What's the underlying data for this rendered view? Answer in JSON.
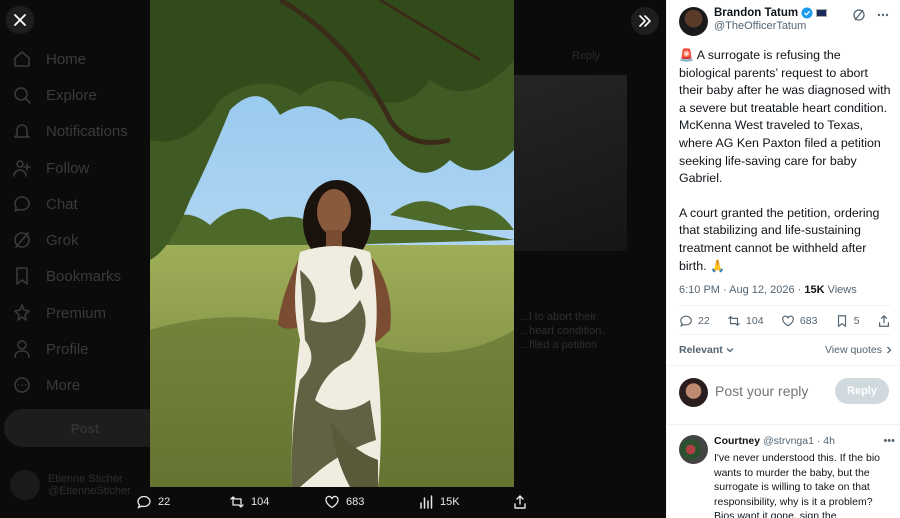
{
  "background_nav": {
    "items": [
      {
        "label": "Home",
        "icon": "home-icon"
      },
      {
        "label": "Explore",
        "icon": "search-icon"
      },
      {
        "label": "Notifications",
        "icon": "bell-icon"
      },
      {
        "label": "Follow",
        "icon": "follow-icon"
      },
      {
        "label": "Chat",
        "icon": "chat-icon"
      },
      {
        "label": "Grok",
        "icon": "grok-icon"
      },
      {
        "label": "Bookmarks",
        "icon": "bookmark-icon"
      },
      {
        "label": "Premium",
        "icon": "premium-icon"
      },
      {
        "label": "Profile",
        "icon": "profile-icon"
      },
      {
        "label": "More",
        "icon": "more-icon"
      }
    ],
    "post_label": "Post",
    "user_name": "Etienne Sticher",
    "user_handle": "@EtienneSticher",
    "right_label": "Reply",
    "right_text": "...l to abort their ...heart condition. ...filed a petition"
  },
  "media_actions": {
    "replies": "22",
    "reposts": "104",
    "likes": "683",
    "views": "15K"
  },
  "tweet": {
    "display_name": "Brandon Tatum",
    "handle": "@TheOfficerTatum",
    "emoji_prefix": "🚨",
    "paragraph1": "A surrogate is refusing the biological parents’ request to abort their baby after he was diagnosed with a severe but treatable heart condition. McKenna West traveled to Texas, where AG Ken Paxton filed a petition seeking life-saving care for baby Gabriel.",
    "paragraph2": "A court granted the petition, ordering that stabilizing and life-sustaining treatment cannot be withheld after birth.",
    "emoji_suffix": "🙏",
    "time": "6:10 PM · Aug 12, 2026 · ",
    "views_count": "15K",
    "views_label": " Views",
    "stats": {
      "replies": "22",
      "reposts": "104",
      "likes": "683",
      "bookmarks": "5"
    },
    "relevant_label": "Relevant",
    "view_quotes_label": "View quotes"
  },
  "reply_box": {
    "placeholder": "Post your reply",
    "button_label": "Reply"
  },
  "reply": {
    "name": "Courtney",
    "handle": "@strvnga1",
    "time": "· 4h",
    "text": "I've never understood this.  If the bio wants to murder the baby, but the surrogate is willing to take on that responsibility, why is it a problem? Bios want it gone, sign the"
  },
  "colors": {
    "accent": "#1d9bf0",
    "text_secondary": "#536471",
    "reply_button_disabled": "#cfd9de"
  }
}
